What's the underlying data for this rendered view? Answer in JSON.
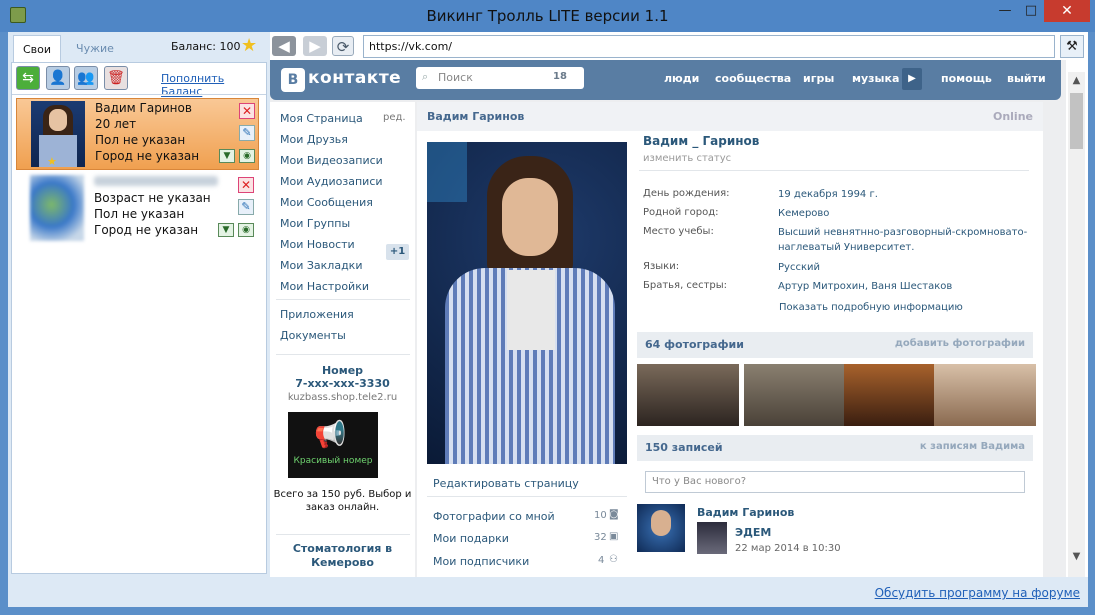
{
  "window": {
    "title": "Викинг Тролль LITE версии 1.1",
    "min": "—",
    "max": "□",
    "close": "✕"
  },
  "left": {
    "tabs": [
      "Свои",
      "Чужие"
    ],
    "balance": "Баланс: 100",
    "topup": "Пополнить Баланс",
    "accounts": [
      {
        "name": "Вадим Гаринов",
        "age": "20 лет",
        "sex": "Пол не указан",
        "city": "Город не указан"
      },
      {
        "age": "Возраст не указан",
        "sex": "Пол не указан",
        "city": "Город не указан"
      }
    ]
  },
  "browser": {
    "url": "https://vk.com/"
  },
  "vk": {
    "brand": "контакте",
    "search_placeholder": "Поиск",
    "search_count": "18",
    "menu": [
      "люди",
      "сообщества",
      "игры",
      "музыка",
      "помощь",
      "выйти"
    ],
    "leftnav": [
      "Моя Страница",
      "Мои Друзья",
      "Мои Видеозаписи",
      "Мои Аудиозаписи",
      "Мои Сообщения",
      "Мои Группы",
      "Мои Новости",
      "Мои Закладки",
      "Мои Настройки",
      "Приложения",
      "Документы"
    ],
    "edit": "ред.",
    "groups_badge": "+1",
    "ad1": {
      "title": "Номер",
      "number": "7-xxx-xxx-3330",
      "url": "kuzbass.shop.tele2.ru",
      "caption": "Красивый номер",
      "text": "Всего за 150 руб. Выбор и заказ онлайн."
    },
    "ad2": {
      "title": "Стоматология в Кемерово"
    },
    "profile": {
      "header_name": "Вадим Гаринов",
      "online": "Online",
      "fullname": "Вадим _ Гаринов",
      "change_status": "изменить статус",
      "info": [
        {
          "k": "День рождения:",
          "v": "19 декабря 1994 г."
        },
        {
          "k": "Родной город:",
          "v": "Кемерово"
        },
        {
          "k": "Место учебы:",
          "v": "Высший невнятнно-разговорный-скромновато-наглеватый Университет."
        },
        {
          "k": "Языки:",
          "v": "Русский"
        },
        {
          "k": "Братья, сестры:",
          "v": "Артур Митрохин, Ваня Шестаков"
        }
      ],
      "show_more": "Показать подробную информацию",
      "edit_page": "Редактировать страницу",
      "links": [
        {
          "label": "Фотографии со мной",
          "count": "10"
        },
        {
          "label": "Мои подарки",
          "count": "32"
        },
        {
          "label": "Мои подписчики",
          "count": "4"
        }
      ],
      "photos_title": "64 фотографии",
      "photos_link": "добавить фотографии",
      "posts_title": "150 записей",
      "posts_link": "к записям Вадима",
      "post_placeholder": "Что у Вас нового?",
      "post": {
        "author": "Вадим Гаринов",
        "repost": "ЭДЕМ",
        "date": "22 мар 2014 в 10:30"
      }
    }
  },
  "footer": {
    "forum": "Обсудить программу на форуме"
  }
}
